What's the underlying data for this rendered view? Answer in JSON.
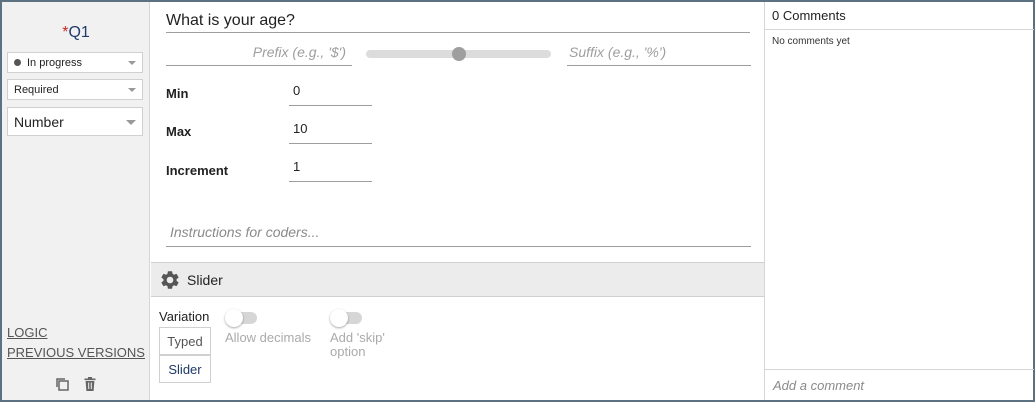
{
  "question": {
    "required_marker": "*",
    "number": "Q1",
    "text": "What is your age?"
  },
  "sidebar": {
    "status": "In progress",
    "requirement": "Required",
    "type": "Number",
    "links": {
      "logic": "LOGIC",
      "previous_versions": "PREVIOUS VERSIONS"
    },
    "icons": [
      "copy-icon",
      "trash-icon"
    ]
  },
  "editor": {
    "prefix_placeholder": "Prefix (e.g., '$')",
    "suffix_placeholder": "Suffix (e.g., '%')",
    "slider_preview_value": 0.5,
    "fields": {
      "min": {
        "label": "Min",
        "value": "0"
      },
      "max": {
        "label": "Max",
        "value": "10"
      },
      "increment": {
        "label": "Increment",
        "value": "1"
      }
    },
    "instructions_placeholder": "Instructions for coders..."
  },
  "settings": {
    "section_title": "Slider",
    "variation_label": "Variation",
    "variations": [
      "Typed",
      "Slider"
    ],
    "selected_variation": "Slider",
    "allow_decimals_label": "Allow decimals",
    "allow_decimals_on": false,
    "skip_option_label": "Add 'skip' option",
    "skip_option_on": false
  },
  "comments": {
    "header": "0 Comments",
    "empty_text": "No comments yet",
    "add_placeholder": "Add a comment"
  },
  "colors": {
    "accent": "#1f3a6b",
    "required": "#c62828",
    "frame": "#5d7281"
  }
}
